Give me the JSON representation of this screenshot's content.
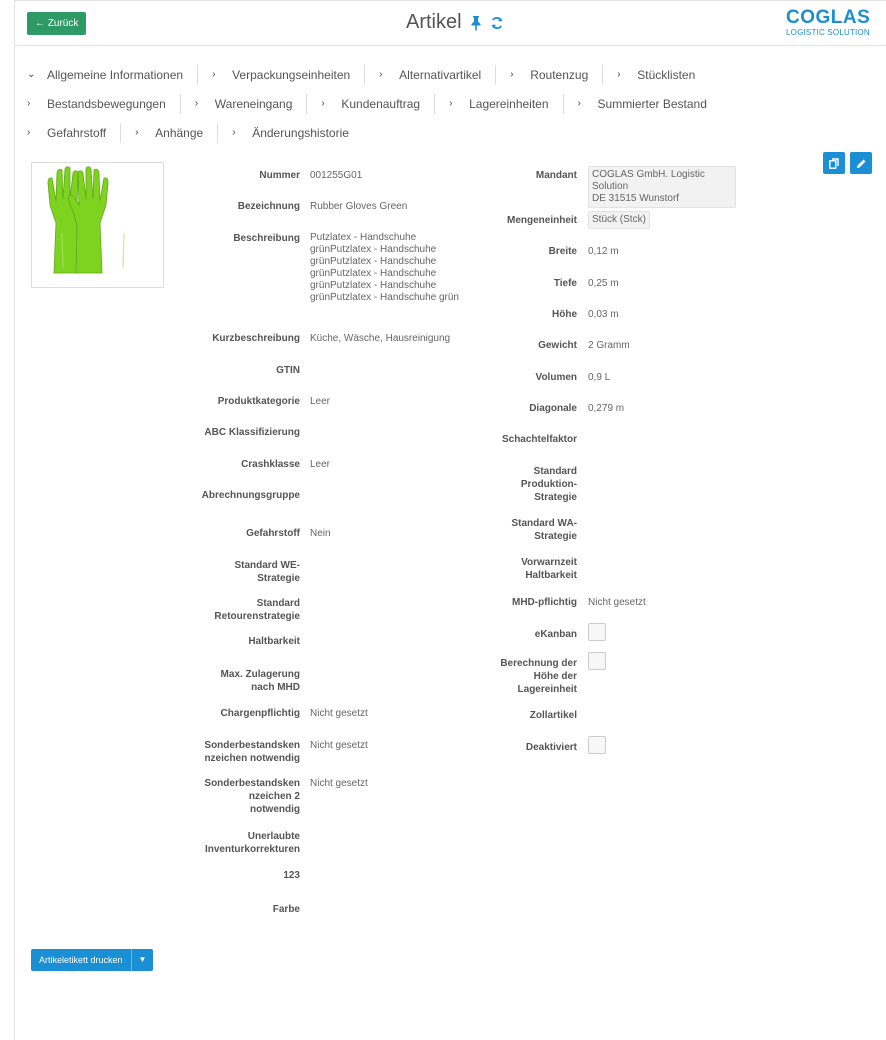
{
  "header": {
    "back_label": "← Zurück",
    "title": "Artikel",
    "logo_main": "COGLAS",
    "logo_sub": "LOGISTIC SOLUTION"
  },
  "tabs": [
    [
      "Allgemeine Informationen",
      "Verpackungseinheiten",
      "Alternativartikel",
      "Routenzug",
      "Stücklisten"
    ],
    [
      "Bestandsbewegungen",
      "Wareneingang",
      "Kundenauftrag",
      "Lagereinheiten",
      "Summierter Bestand"
    ],
    [
      "Gefahrstoff",
      "Anhänge",
      "Änderungshistorie"
    ]
  ],
  "left": {
    "nummer": {
      "label": "Nummer",
      "value": "001255G01"
    },
    "bezeichnung": {
      "label": "Bezeichnung",
      "value": "Rubber Gloves Green"
    },
    "beschreibung": {
      "label": "Beschreibung",
      "value_lines": [
        "Putzlatex - Handschuhe",
        "grünPutzlatex - Handschuhe",
        "grünPutzlatex - Handschuhe",
        "grünPutzlatex - Handschuhe",
        "grünPutzlatex - Handschuhe",
        "grünPutzlatex - Handschuhe grün"
      ]
    },
    "kurzbeschreibung": {
      "label": "Kurzbeschreibung",
      "value": "Küche, Wäsche, Hausreinigung"
    },
    "gtin": {
      "label": "GTIN",
      "value": ""
    },
    "produktkategorie": {
      "label": "Produktkategorie",
      "value": "Leer"
    },
    "abc": {
      "label": "ABC Klassifizierung",
      "value": ""
    },
    "crashklasse": {
      "label": "Crashklasse",
      "value": "Leer"
    },
    "abrechnungsgruppe": {
      "label": "Abrechnungsgruppe",
      "value": ""
    },
    "gefahrstoff": {
      "label": "Gefahrstoff",
      "value": "Nein"
    },
    "standard_we": {
      "label_lines": [
        "Standard WE-",
        "Strategie"
      ],
      "value": ""
    },
    "standard_retouren": {
      "label_lines": [
        "Standard",
        "Retourenstrategie"
      ],
      "value": ""
    },
    "haltbarkeit": {
      "label": "Haltbarkeit",
      "value": ""
    },
    "max_zulagerung": {
      "label_lines": [
        "Max. Zulagerung",
        "nach MHD"
      ],
      "value": ""
    },
    "chargenpflichtig": {
      "label": "Chargenpflichtig",
      "value": "Nicht gesetzt"
    },
    "sonder1": {
      "label_lines": [
        "Sonderbestandsken",
        "nzeichen notwendig"
      ],
      "value": "Nicht gesetzt"
    },
    "sonder2": {
      "label_lines": [
        "Sonderbestandsken",
        "nzeichen 2",
        "notwendig"
      ],
      "value": "Nicht gesetzt"
    },
    "unerlaubte": {
      "label_lines": [
        "Unerlaubte",
        "Inventurkorrekturen"
      ],
      "value": ""
    },
    "f123": {
      "label": "123",
      "value": ""
    },
    "farbe": {
      "label": "Farbe",
      "value": ""
    }
  },
  "right": {
    "mandant": {
      "label": "Mandant",
      "value_lines": [
        "COGLAS GmbH. Logistic Solution",
        "DE 31515 Wunstorf"
      ]
    },
    "mengeneinheit": {
      "label": "Mengeneinheit",
      "value": "Stück (Stck)"
    },
    "breite": {
      "label": "Breite",
      "value": "0,12 m"
    },
    "tiefe": {
      "label": "Tiefe",
      "value": "0,25 m"
    },
    "hoehe": {
      "label": "Höhe",
      "value": "0,03 m"
    },
    "gewicht": {
      "label": "Gewicht",
      "value": "2 Gramm"
    },
    "volumen": {
      "label": "Volumen",
      "value": "0,9 L"
    },
    "diagonale": {
      "label": "Diagonale",
      "value": "0,279 m"
    },
    "schachtelfaktor": {
      "label": "Schachtelfaktor",
      "value": ""
    },
    "std_produktion": {
      "label_lines": [
        "Standard",
        "Produktion-",
        "Strategie"
      ],
      "value": ""
    },
    "std_wa": {
      "label_lines": [
        "Standard WA-",
        "Strategie"
      ],
      "value": ""
    },
    "vorwarnzeit": {
      "label_lines": [
        "Vorwarnzeit",
        "Haltbarkeit"
      ],
      "value": ""
    },
    "mhd": {
      "label": "MHD-pflichtig",
      "value": "Nicht gesetzt"
    },
    "ekanban": {
      "label": "eKanban",
      "checked": false
    },
    "berechnung": {
      "label_lines": [
        "Berechnung der",
        "Höhe der",
        "Lagereinheit"
      ],
      "checked": false
    },
    "zollartikel": {
      "label": "Zollartikel",
      "value": ""
    },
    "deaktiviert": {
      "label": "Deaktiviert",
      "checked": false
    }
  },
  "footer": {
    "print_label": "Artikeletikett drucken"
  },
  "colors": {
    "back_button": "#2e9b66",
    "primary": "#1a8fd4",
    "logo": "#1d8fd0",
    "glove": "#7ed321"
  }
}
